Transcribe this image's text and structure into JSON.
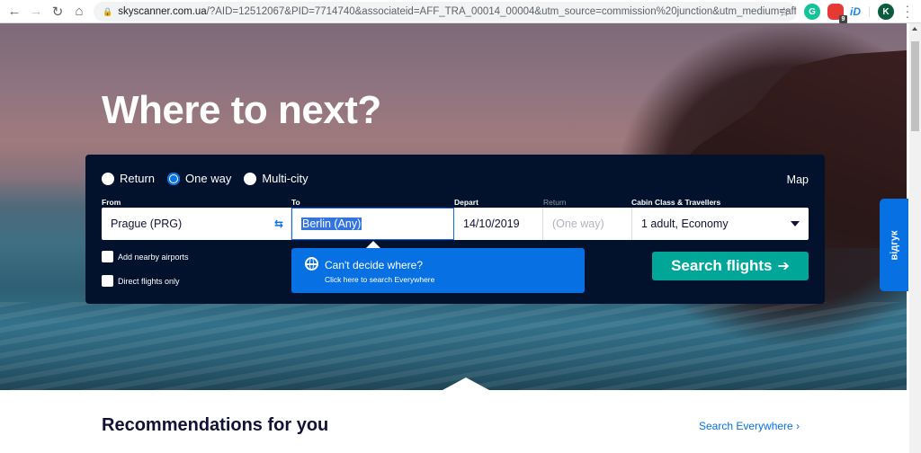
{
  "browser": {
    "url_domain": "skyscanner.com.ua",
    "url_rest": "/?AID=12512067&PID=7714740&associateid=AFF_TRA_00014_00004&utm_source=commission%20junction&utm_medium=affiliate&u...",
    "extensions": [
      {
        "name": "grammarly",
        "label": "G"
      },
      {
        "name": "opera-ext",
        "label": "",
        "badge": "9"
      },
      {
        "name": "id-ext",
        "label": "iD"
      }
    ],
    "profile_initial": "K"
  },
  "hero": {
    "title": "Where to next?"
  },
  "search": {
    "trip_types": [
      {
        "label": "Return",
        "checked": false
      },
      {
        "label": "One way",
        "checked": true
      },
      {
        "label": "Multi-city",
        "checked": false
      }
    ],
    "map_label": "Map",
    "labels": {
      "from": "From",
      "to": "To",
      "depart": "Depart",
      "return": "Return",
      "cabin": "Cabin Class & Travellers"
    },
    "values": {
      "from": "Prague (PRG)",
      "to": "Berlin (Any)",
      "depart": "14/10/2019",
      "return": "(One way)",
      "cabin": "1 adult, Economy"
    },
    "checkboxes": {
      "nearby": "Add nearby airports",
      "direct": "Direct flights only"
    },
    "everywhere": {
      "title": "Can't decide where?",
      "subtitle": "Click here to search Everywhere"
    },
    "submit_label": "Search flights",
    "submit_arrow": "➔"
  },
  "feedback_label": "відгук",
  "recommendations": {
    "title": "Recommendations for you",
    "link": "Search Everywhere",
    "link_chevron": "›"
  },
  "colors": {
    "panel_bg": "#02122c",
    "accent_blue": "#0770e3",
    "search_green": "#00a698"
  }
}
